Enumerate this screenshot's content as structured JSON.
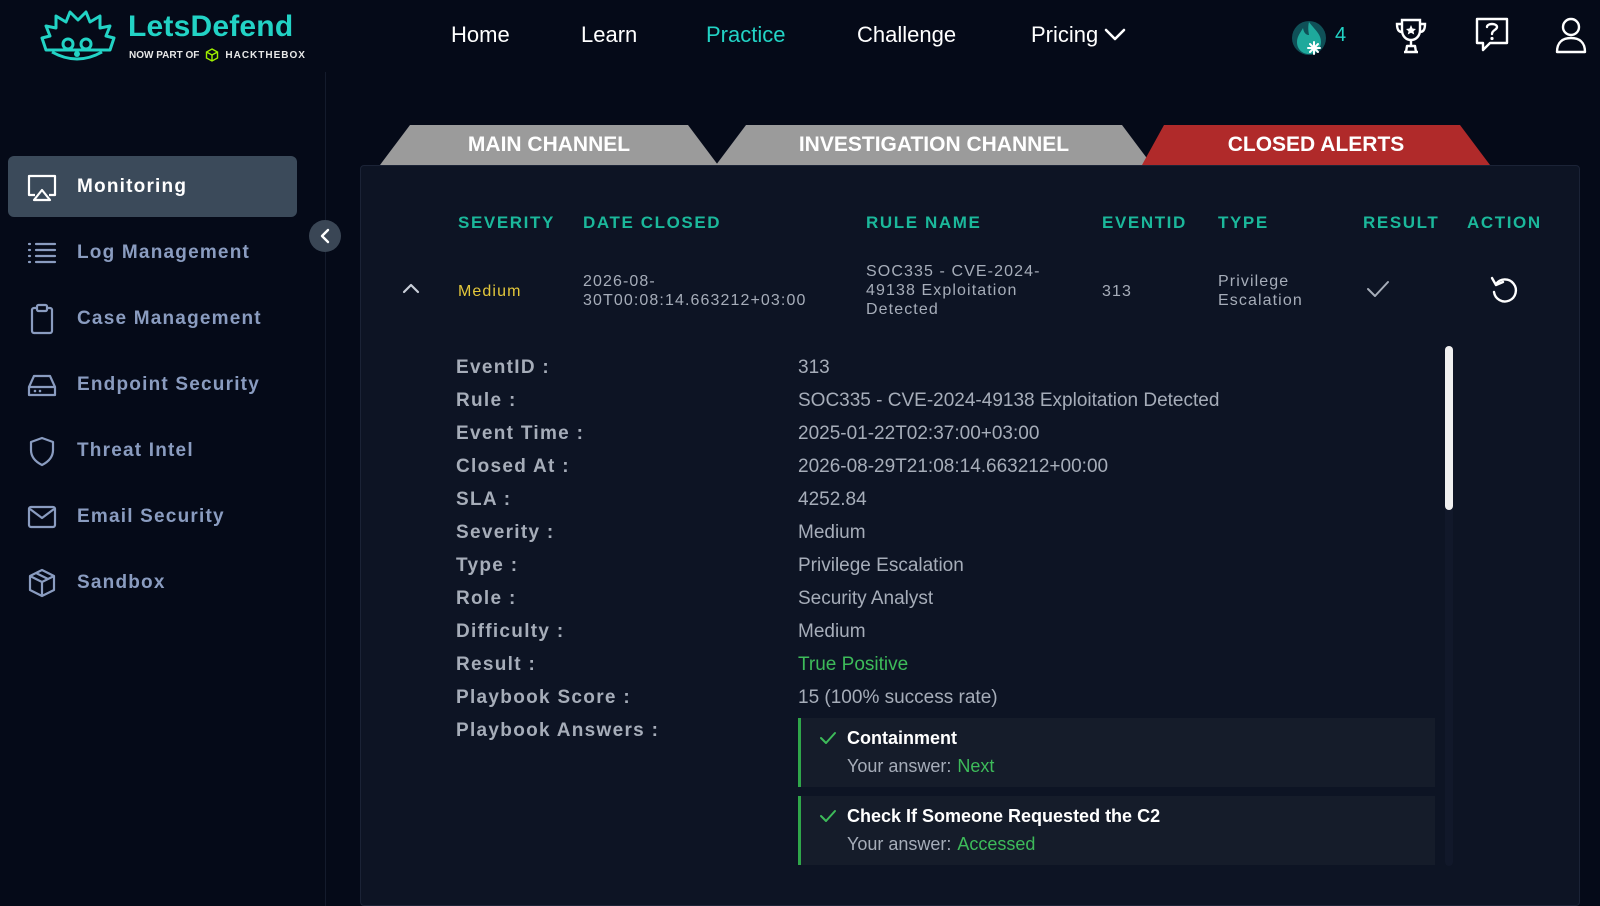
{
  "brand": {
    "name": "LetsDefend",
    "tagline_prefix": "NOW PART OF",
    "tagline_partner": "HACKTHEBOX",
    "accent": "#22d3c5"
  },
  "nav": {
    "home": "Home",
    "learn": "Learn",
    "practice": "Practice",
    "challenge": "Challenge",
    "pricing": "Pricing",
    "streak_count": "4",
    "icons": [
      "streak-flame-icon",
      "trophy-icon",
      "help-icon",
      "user-icon"
    ]
  },
  "sidebar": {
    "items": [
      {
        "label": "Monitoring",
        "icon": "monitor-icon"
      },
      {
        "label": "Log Management",
        "icon": "list-icon"
      },
      {
        "label": "Case Management",
        "icon": "clipboard-icon"
      },
      {
        "label": "Endpoint Security",
        "icon": "hard-drive-icon"
      },
      {
        "label": "Threat Intel",
        "icon": "shield-icon"
      },
      {
        "label": "Email Security",
        "icon": "mail-icon"
      },
      {
        "label": "Sandbox",
        "icon": "box-icon"
      }
    ]
  },
  "tabs": {
    "main": "MAIN CHANNEL",
    "investigation": "INVESTIGATION CHANNEL",
    "closed": "CLOSED ALERTS",
    "closed_color": "#b02a2a",
    "inactive_color": "#9b9b9b"
  },
  "table": {
    "headers": {
      "severity": "SEVERITY",
      "date_closed": "DATE CLOSED",
      "rule_name": "RULE NAME",
      "eventid": "EVENTID",
      "type": "TYPE",
      "result": "RESULT",
      "action": "ACTION"
    },
    "row": {
      "severity": "Medium",
      "date_closed_1": "2026-08-",
      "date_closed_2": "30T00:08:14.663212+03:00",
      "rule_1": "SOC335 - CVE-2024-",
      "rule_2": "49138 Exploitation",
      "rule_3": "Detected",
      "eventid": "313",
      "type_1": "Privilege",
      "type_2": "Escalation"
    }
  },
  "details": {
    "eventid_k": "EventID :",
    "eventid_v": "313",
    "rule_k": "Rule :",
    "rule_v": "SOC335 - CVE-2024-49138 Exploitation Detected",
    "event_time_k": "Event Time :",
    "event_time_v": "2025-01-22T02:37:00+03:00",
    "closed_at_k": "Closed At :",
    "closed_at_v": "2026-08-29T21:08:14.663212+00:00",
    "sla_k": "SLA :",
    "sla_v": "4252.84",
    "severity_k": "Severity :",
    "severity_v": "Medium",
    "type_k": "Type :",
    "type_v": "Privilege Escalation",
    "role_k": "Role :",
    "role_v": "Security Analyst",
    "difficulty_k": "Difficulty :",
    "difficulty_v": "Medium",
    "result_k": "Result :",
    "result_v": "True Positive",
    "playbook_score_k": "Playbook Score :",
    "playbook_score_v": "15 (100% success rate)",
    "playbook_answers_k": "Playbook Answers :",
    "answers": [
      {
        "question": "Containment",
        "label": "Your answer:",
        "answer": "Next"
      },
      {
        "question": "Check If Someone Requested the C2",
        "label": "Your answer:",
        "answer": "Accessed"
      }
    ]
  }
}
